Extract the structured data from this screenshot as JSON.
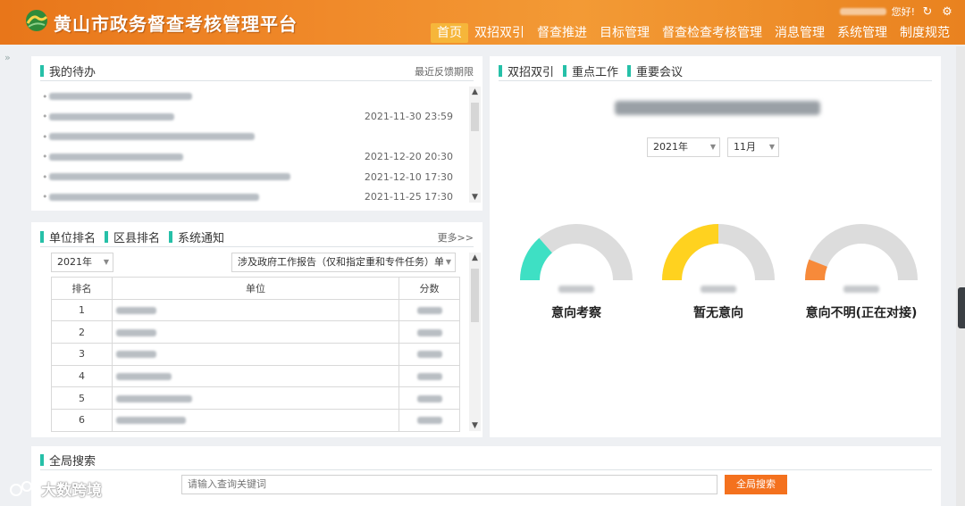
{
  "header": {
    "title": "黄山市政务督查考核管理平台",
    "greeting": "您好!",
    "nav": [
      "首页",
      "双招双引",
      "督查推进",
      "目标管理",
      "督查检查考核管理",
      "消息管理",
      "系统管理",
      "制度规范"
    ],
    "active_nav": "首页"
  },
  "todo": {
    "tab": "我的待办",
    "link": "最近反馈期限",
    "times": [
      "",
      "2021-11-30 23:59",
      "",
      "2021-12-20 20:30",
      "2021-12-10 17:30",
      "2021-11-25 17:30"
    ]
  },
  "ranking": {
    "tabs": [
      "单位排名",
      "区县排名",
      "系统通知"
    ],
    "more": "更多>>",
    "year_select": "2021年",
    "category_select": "涉及政府工作报告（仅和指定重和专件任务）单",
    "columns": [
      "排名",
      "单位",
      "分数"
    ],
    "ranks": [
      "1",
      "2",
      "3",
      "4",
      "5",
      "6"
    ]
  },
  "right_panel": {
    "tabs": [
      "双招双引",
      "重点工作",
      "重要会议"
    ],
    "year_select": "2021年",
    "month_select": "11月",
    "gauges": [
      {
        "label": "意向考察",
        "fraction": 0.27,
        "color": "#3ee0c4"
      },
      {
        "label": "暂无意向",
        "fraction": 0.5,
        "color": "#ffd21f"
      },
      {
        "label": "意向不明(正在对接)",
        "fraction": 0.12,
        "color": "#f78a3a"
      }
    ],
    "track_color": "#dcdcdc"
  },
  "search": {
    "tab": "全局搜索",
    "placeholder": "请输入查询关键词",
    "button": "全局搜索"
  },
  "watermark": "大数跨境",
  "colors": {
    "accent": "#26c0a8",
    "header": "#ef8423",
    "button": "#f4711e"
  }
}
